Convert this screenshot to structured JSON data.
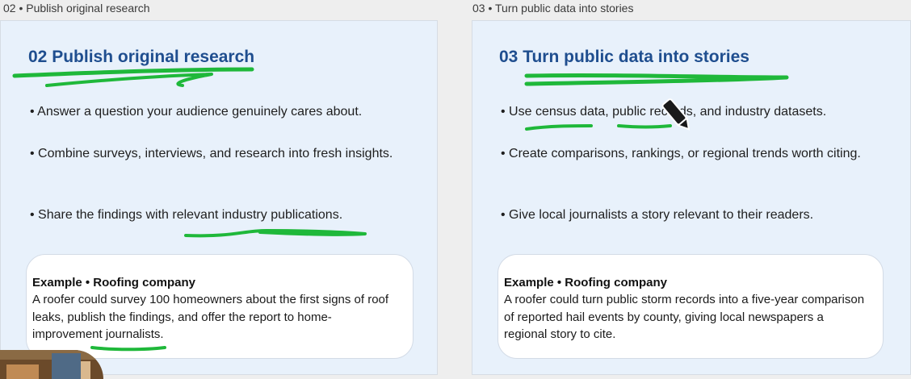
{
  "left": {
    "card_label": "02 • Publish original research",
    "title": "02  Publish original research",
    "bullets": [
      "• Answer a question your audience genuinely cares about.",
      "• Combine surveys, interviews, and research into fresh insights.",
      "• Share the findings with relevant industry publications."
    ],
    "example_title": "Example • Roofing company",
    "example_body": "A roofer could survey 100 homeowners about the first signs of roof leaks, publish the findings, and offer the report to home-improvement journalists."
  },
  "right": {
    "card_label": "03 • Turn public data into stories",
    "title": "03  Turn public data into stories",
    "bullets": [
      "• Use census data, public records, and industry datasets.",
      "• Create comparisons, rankings, or regional trends worth citing.",
      "• Give local journalists a story relevant to their readers."
    ],
    "example_title": "Example • Roofing company",
    "example_body": "A roofer could turn public storm records into a five-year comparison of reported hail events by county, giving local newspapers a regional story to cite."
  },
  "colors": {
    "title": "#1f4e8f",
    "slide_bg": "#e8f1fb",
    "annotation": "#1fb83a"
  },
  "icons": {
    "cursor": "pen-cursor-icon"
  }
}
